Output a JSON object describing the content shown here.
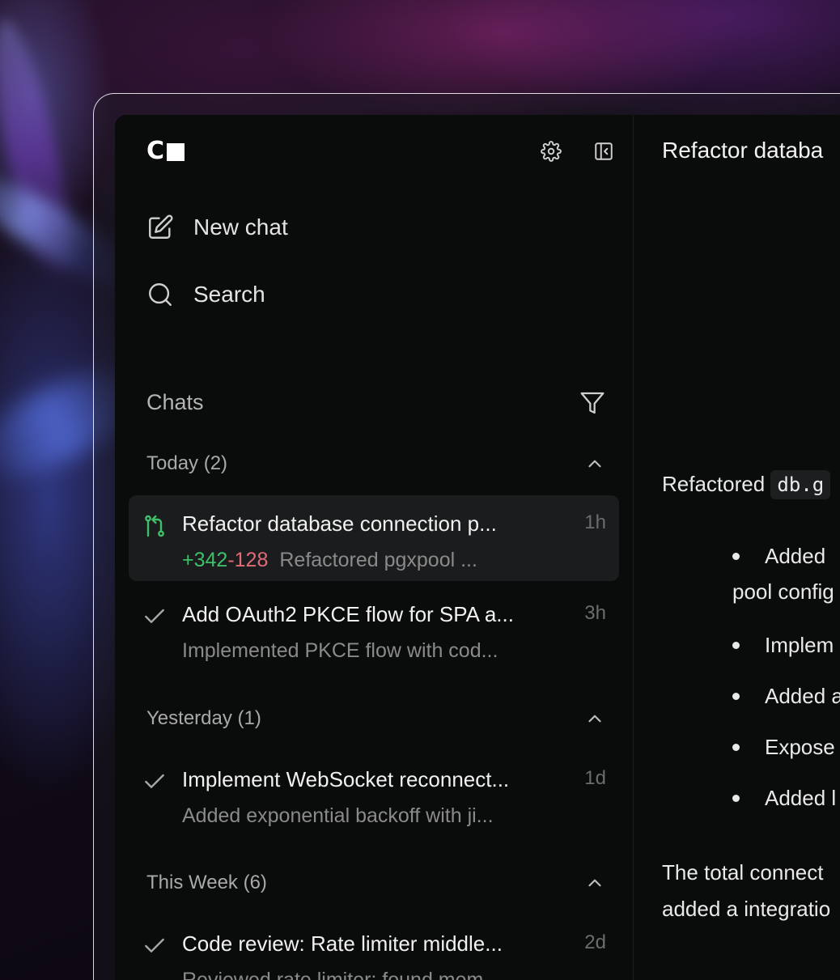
{
  "sidebar": {
    "logo_text": "C",
    "header_icons": [
      "gear-icon",
      "sidebar-collapse-icon"
    ],
    "nav": [
      {
        "label": "New chat",
        "icon": "compose-icon"
      },
      {
        "label": "Search",
        "icon": "search-icon"
      }
    ],
    "section_title": "Chats",
    "groups": [
      {
        "label": "Today (2)",
        "chats": [
          {
            "title": "Refactor database connection p...",
            "time": "1h",
            "additions": "+342",
            "deletions": "-128",
            "subtitle": "Refactored pgxpool ...",
            "icon": "git-pull-request-icon",
            "active": true
          },
          {
            "title": "Add OAuth2 PKCE flow for SPA a...",
            "time": "3h",
            "subtitle": "Implemented PKCE flow with cod...",
            "icon": "check-icon"
          }
        ]
      },
      {
        "label": "Yesterday (1)",
        "chats": [
          {
            "title": "Implement WebSocket reconnect...",
            "time": "1d",
            "subtitle": "Added exponential backoff with ji...",
            "icon": "check-icon"
          }
        ]
      },
      {
        "label": "This Week (6)",
        "chats": [
          {
            "title": "Code review: Rate limiter middle...",
            "time": "2d",
            "subtitle": "Reviewed rate limiter; found mem...",
            "icon": "check-icon"
          }
        ]
      }
    ]
  },
  "main": {
    "title": "Refactor databa",
    "intro_text": "Refactored",
    "intro_code": "db.g",
    "bullets": [
      {
        "text": "Added",
        "cont": "pool config"
      },
      {
        "text": "Implem"
      },
      {
        "text": "Added a"
      },
      {
        "text": "Expose"
      },
      {
        "text": "Added l"
      }
    ],
    "outro_line1": "The total connect",
    "outro_line2": "added a integratio"
  },
  "colors": {
    "accent_green": "#3fbf6a",
    "accent_red": "#e26b78",
    "background": "#0a0b0b"
  }
}
